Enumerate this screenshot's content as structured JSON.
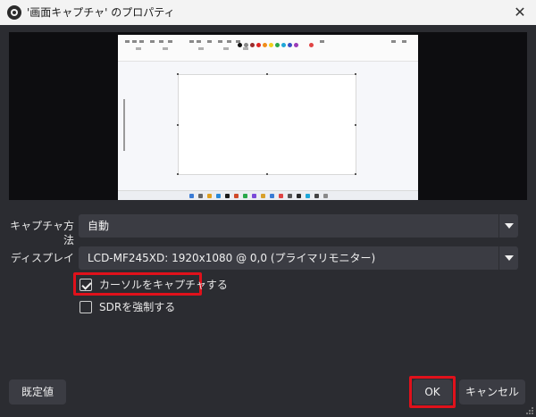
{
  "window": {
    "title": "'画面キャプチャ' のプロパティ",
    "close_glyph": "✕"
  },
  "icons": {
    "app": "obs-logo-icon",
    "close": "close-icon",
    "dropdown": "chevron-down-icon",
    "check": "checkmark-icon",
    "resize": "resize-grip-icon"
  },
  "form": {
    "capture_method": {
      "label": "キャプチャ方法",
      "value": "自動"
    },
    "display": {
      "label": "ディスプレイ",
      "value": "LCD-MF245XD: 1920x1080 @ 0,0 (プライマリモニター)"
    },
    "capture_cursor": {
      "label": "カーソルをキャプチャする",
      "checked": true
    },
    "force_sdr": {
      "label": "SDRを強制する",
      "checked": false
    }
  },
  "buttons": {
    "defaults": "既定値",
    "ok": "OK",
    "cancel": "キャンセル"
  },
  "colors": {
    "dialog_bg": "#2b2c31",
    "control_bg": "#3b3c43",
    "highlight": "#e0111b",
    "preview_bg": "#0d0d10"
  }
}
